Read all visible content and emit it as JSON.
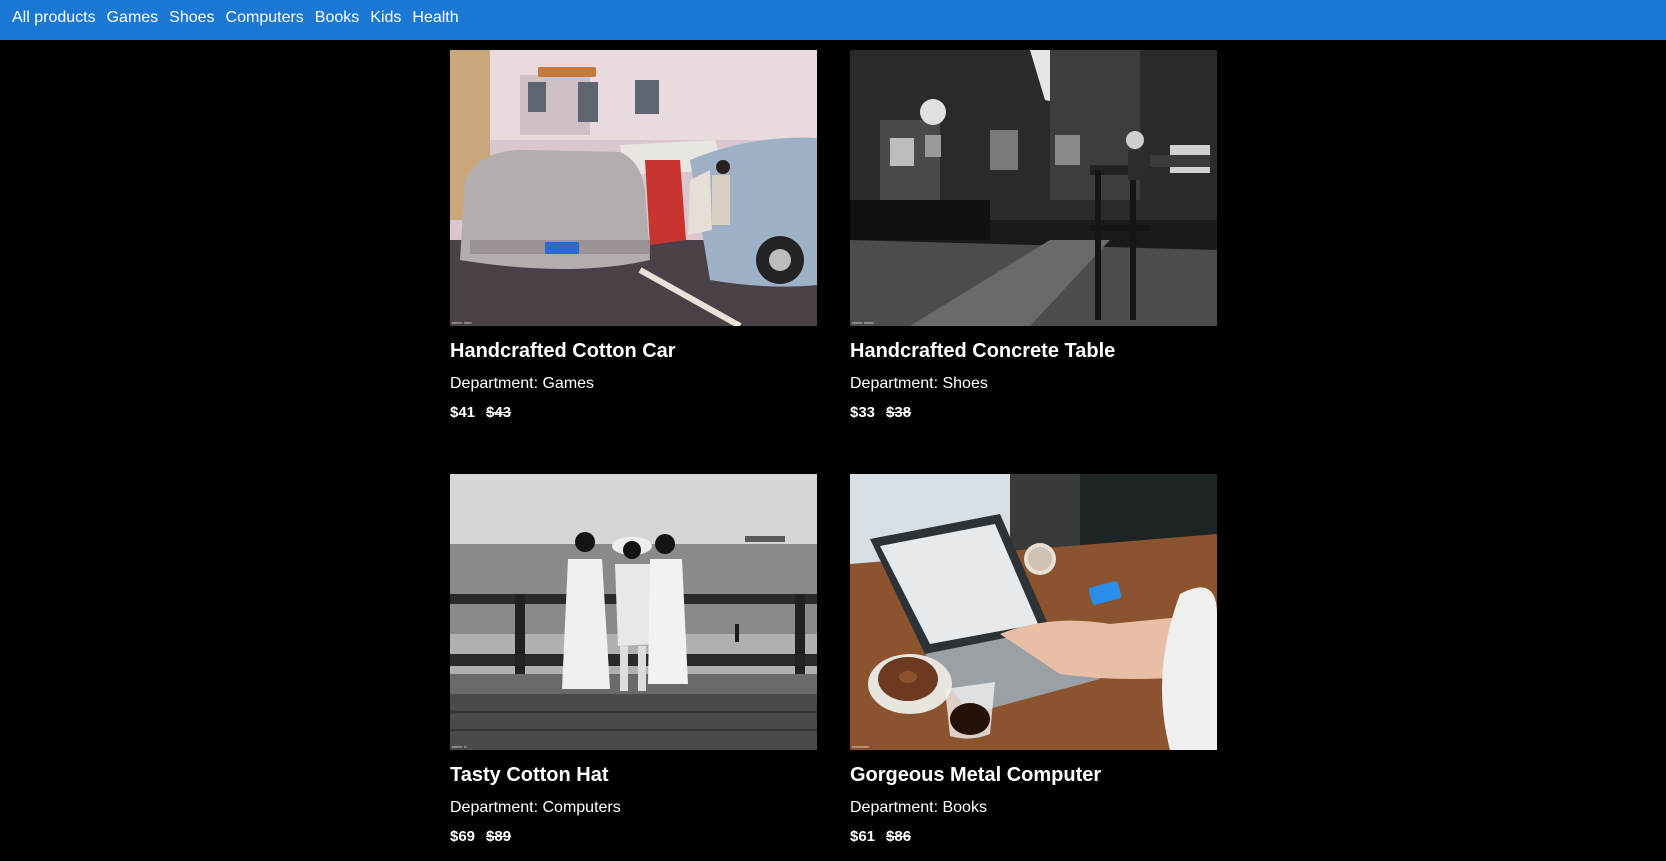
{
  "nav": {
    "items": [
      {
        "label": "All products"
      },
      {
        "label": "Games"
      },
      {
        "label": "Shoes"
      },
      {
        "label": "Computers"
      },
      {
        "label": "Books"
      },
      {
        "label": "Kids"
      },
      {
        "label": "Health"
      }
    ]
  },
  "products": [
    {
      "title": "Handcrafted Cotton Car",
      "department": "Department: Games",
      "price": "$41",
      "old_price": "$43",
      "image": "photo of vintage cars in a parking lot"
    },
    {
      "title": "Handcrafted Concrete Table",
      "department": "Department: Shoes",
      "price": "$33",
      "old_price": "$38",
      "image": "black and white photo of a bar interior"
    },
    {
      "title": "Tasty Cotton Hat",
      "department": "Department: Computers",
      "price": "$69",
      "old_price": "$89",
      "image": "black and white photo of three women at a seaside railing"
    },
    {
      "title": "Gorgeous Metal Computer",
      "department": "Department: Books",
      "price": "$61",
      "old_price": "$86",
      "image": "photo of a person typing on a laptop with coffee and a donut"
    }
  ],
  "colors": {
    "nav_background": "#1a78d4",
    "page_background": "#000000",
    "text": "#ffffff"
  }
}
